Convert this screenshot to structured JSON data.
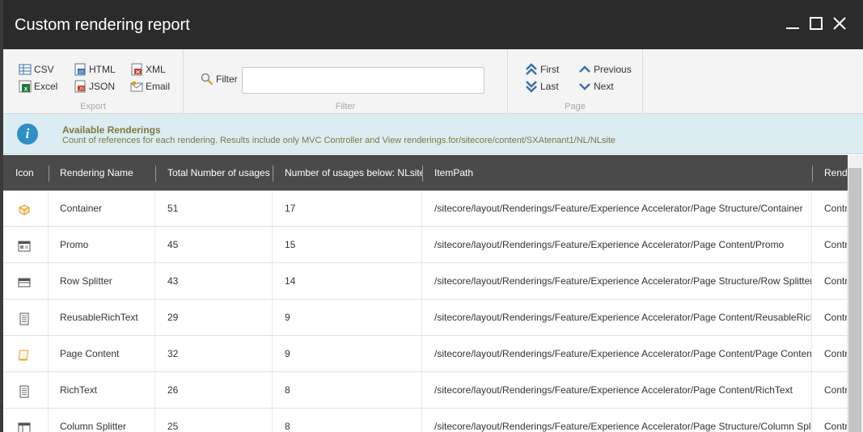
{
  "window": {
    "title": "Custom rendering report"
  },
  "ribbon": {
    "export": {
      "label": "Export",
      "csv": "CSV",
      "excel": "Excel",
      "html": "HTML",
      "json": "JSON",
      "xml": "XML",
      "email": "Email"
    },
    "filter": {
      "label": "Filter",
      "button": "Filter",
      "value": ""
    },
    "page": {
      "label": "Page",
      "first": "First",
      "last": "Last",
      "previous": "Previous",
      "next": "Next"
    }
  },
  "info": {
    "title": "Available Renderings",
    "description": "Count of references for each rendering. Results include only MVC Controller and View renderings.for/sitecore/content/SXAtenant1/NL/NLsite"
  },
  "table": {
    "headers": [
      "Icon",
      "Rendering Name",
      "Total Number of usages",
      "Number of usages below: NLsite",
      "ItemPath",
      "Rendering Type"
    ],
    "rows": [
      {
        "icon": "box-icon",
        "name": "Container",
        "total": "51",
        "below": "17",
        "path": "/sitecore/layout/Renderings/Feature/Experience Accelerator/Page Structure/Container",
        "type": "Controller Rendering"
      },
      {
        "icon": "promo-icon",
        "name": "Promo",
        "total": "45",
        "below": "15",
        "path": "/sitecore/layout/Renderings/Feature/Experience Accelerator/Page Content/Promo",
        "type": "Controller Rendering"
      },
      {
        "icon": "row-splitter-icon",
        "name": "Row Splitter",
        "total": "43",
        "below": "14",
        "path": "/sitecore/layout/Renderings/Feature/Experience Accelerator/Page Structure/Row Splitter",
        "type": "Controller Rendering"
      },
      {
        "icon": "document-icon",
        "name": "ReusableRichText",
        "total": "29",
        "below": "9",
        "path": "/sitecore/layout/Renderings/Feature/Experience Accelerator/Page Content/ReusableRichText",
        "type": "Controller Rendering"
      },
      {
        "icon": "page-content-icon",
        "name": "Page Content",
        "total": "32",
        "below": "9",
        "path": "/sitecore/layout/Renderings/Feature/Experience Accelerator/Page Content/Page Content",
        "type": "Controller Rendering"
      },
      {
        "icon": "document-icon",
        "name": "RichText",
        "total": "26",
        "below": "8",
        "path": "/sitecore/layout/Renderings/Feature/Experience Accelerator/Page Content/RichText",
        "type": "Controller Rendering"
      },
      {
        "icon": "column-splitter-icon",
        "name": "Column Splitter",
        "total": "25",
        "below": "8",
        "path": "/sitecore/layout/Renderings/Feature/Experience Accelerator/Page Structure/Column Splitter",
        "type": "Controller Rendering"
      }
    ]
  }
}
